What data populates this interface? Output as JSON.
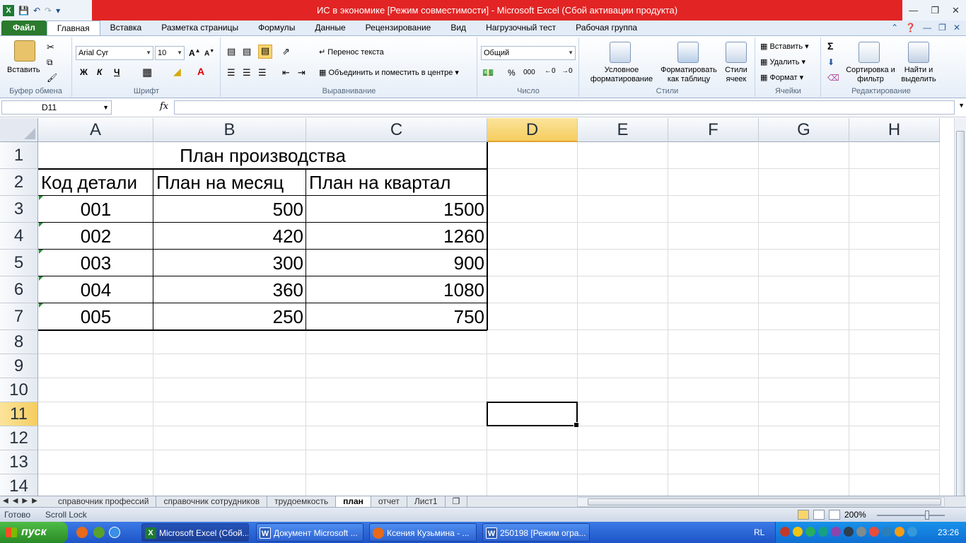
{
  "window": {
    "title": "ИС в экономике  [Режим совместимости]  -  Microsoft Excel (Сбой активации продукта)"
  },
  "ribbon": {
    "tabs": [
      "Файл",
      "Главная",
      "Вставка",
      "Разметка страницы",
      "Формулы",
      "Данные",
      "Рецензирование",
      "Вид",
      "Нагрузочный тест",
      "Рабочая группа"
    ],
    "active_tab": "Главная",
    "clipboard": {
      "paste": "Вставить",
      "label": "Буфер обмена"
    },
    "font": {
      "name": "Arial Cyr",
      "size": "10",
      "bold": "Ж",
      "italic": "К",
      "underline": "Ч",
      "label": "Шрифт"
    },
    "alignment": {
      "wrap": "Перенос текста",
      "merge": "Объединить и поместить в центре",
      "label": "Выравнивание"
    },
    "number": {
      "format": "Общий",
      "percent": "%",
      "thousands": "000",
      "label": "Число"
    },
    "styles": {
      "conditional": "Условное форматирование",
      "as_table": "Форматировать как таблицу",
      "cell_styles": "Стили ячеек",
      "label": "Стили"
    },
    "cells": {
      "insert": "Вставить",
      "delete": "Удалить",
      "format": "Формат",
      "label": "Ячейки"
    },
    "editing": {
      "sum": "Σ",
      "sort": "Сортировка и фильтр",
      "find": "Найти и выделить",
      "label": "Редактирование"
    }
  },
  "formula_bar": {
    "name_box": "D11",
    "fx": "fx",
    "value": ""
  },
  "columns": [
    "A",
    "B",
    "C",
    "D",
    "E",
    "F",
    "G",
    "H"
  ],
  "rows": [
    "1",
    "2",
    "3",
    "4",
    "5",
    "6",
    "7",
    "8",
    "9",
    "10",
    "11",
    "12",
    "13",
    "14"
  ],
  "selected": {
    "col": "D",
    "row": "11"
  },
  "sheet": {
    "title": "План производства",
    "headers": [
      "Код детали",
      "План на месяц",
      "План на квартал"
    ],
    "data": [
      [
        "001",
        "500",
        "1500"
      ],
      [
        "002",
        "420",
        "1260"
      ],
      [
        "003",
        "300",
        "900"
      ],
      [
        "004",
        "360",
        "1080"
      ],
      [
        "005",
        "250",
        "750"
      ]
    ]
  },
  "sheet_tabs": [
    "справочник профессий",
    "справочник сотрудников",
    "трудоемкость",
    "план",
    "отчет",
    "Лист1"
  ],
  "active_sheet": "план",
  "status": {
    "ready": "Готово",
    "scroll_lock": "Scroll Lock",
    "zoom": "200%"
  },
  "taskbar": {
    "start": "пуск",
    "buttons": [
      "Microsoft Excel (Сбой...",
      "Документ Microsoft ...",
      "Ксения Кузьмина - ...",
      "250198 [Режим огра..."
    ],
    "lang": "RL",
    "clock": "23:26"
  },
  "colors": {
    "title_bar": "#e22424",
    "file_tab": "#2b7a2d",
    "selected_header": "#f6cd5f",
    "taskbar": "#245edb",
    "start": "#3a9e35"
  }
}
